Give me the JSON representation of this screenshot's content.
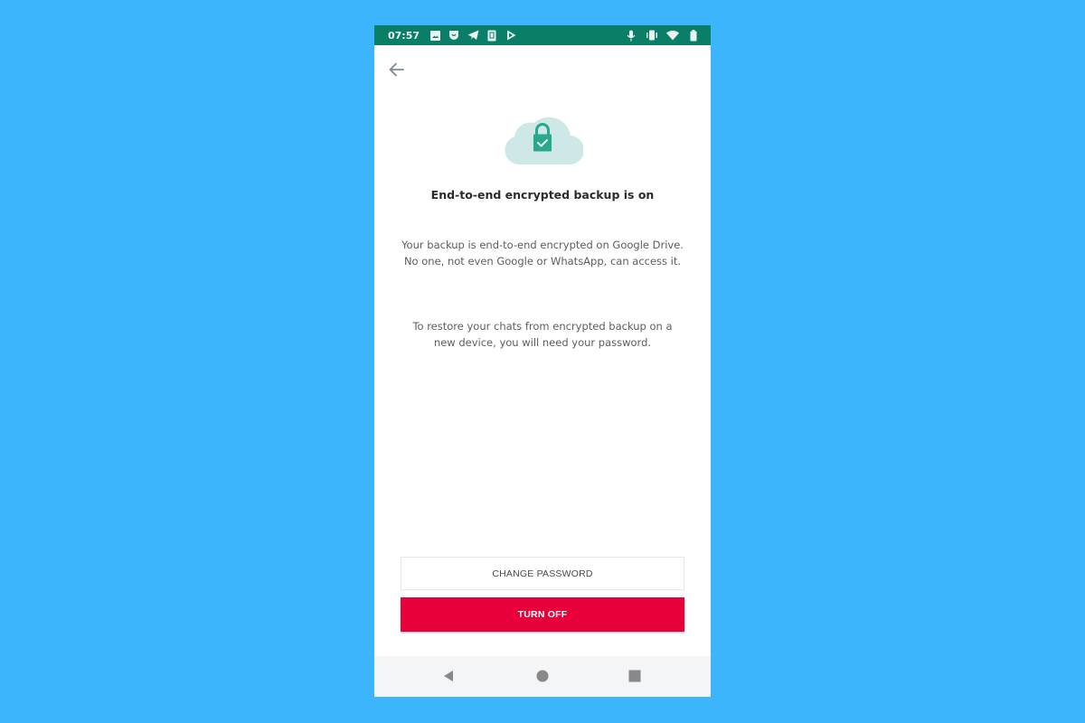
{
  "status_bar": {
    "time": "07:57",
    "left_icons": [
      "gallery-icon",
      "app-notification-icon",
      "telegram-icon",
      "sim-card-icon",
      "play-store-icon"
    ],
    "right_icons": [
      "microphone-icon",
      "vibrate-icon",
      "wifi-icon",
      "battery-icon"
    ],
    "background": "#0a7e66"
  },
  "header": {
    "back_icon": "arrow-left-icon"
  },
  "hero": {
    "icon": "cloud-lock-check-icon",
    "cloud_color": "#cde8e6",
    "lock_color": "#2aa78f"
  },
  "content": {
    "title": "End-to-end encrypted backup is on",
    "paragraph_1": "Your backup is end-to-end encrypted on Google Drive. No one, not even Google or WhatsApp, can access it.",
    "paragraph_2": "To restore your chats from encrypted backup on a new device, you will need your password."
  },
  "actions": {
    "change_password_label": "CHANGE PASSWORD",
    "turn_off_label": "TURN OFF",
    "turn_off_color": "#e8003a"
  },
  "nav_bar": {
    "buttons": [
      "back-triangle-icon",
      "home-circle-icon",
      "recents-square-icon"
    ]
  },
  "page_background": "#3db5fc"
}
